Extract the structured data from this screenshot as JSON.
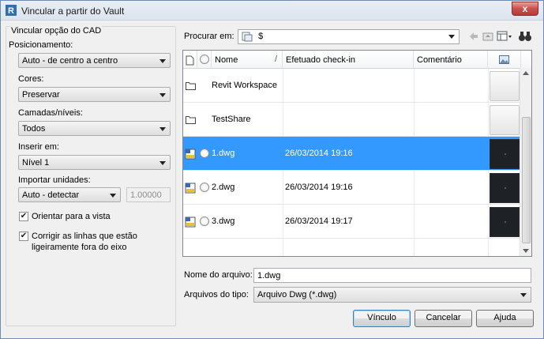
{
  "window": {
    "title": "Vincular a partir do Vault",
    "close_glyph": "x"
  },
  "cad_options": {
    "group_title": "Vincular opção do CAD",
    "positioning": {
      "label": "Posicionamento:",
      "value": "Auto - de centro a centro"
    },
    "colors": {
      "label": "Cores:",
      "value": "Preservar"
    },
    "layers": {
      "label": "Camadas/níveis:",
      "value": "Todos"
    },
    "insert": {
      "label": "Inserir em:",
      "value": "Nível 1"
    },
    "units": {
      "label": "Importar unidades:",
      "value": "Auto - detectar",
      "factor": "1.00000"
    },
    "orient": {
      "label": "Orientar para a vista",
      "checked": true
    },
    "correct": {
      "label_line1": "Corrigir as linhas que estão",
      "label_line2": "ligeiramente fora do eixo",
      "checked": true
    }
  },
  "browser": {
    "search_label": "Procurar em:",
    "search_value": "$",
    "columns": {
      "name": "Nome",
      "sort_glyph": "/",
      "checkin": "Efetuado check-in",
      "comment": "Comentário"
    },
    "rows": [
      {
        "name": "Revit Workspace",
        "date": "",
        "type": "folder",
        "selected": false
      },
      {
        "name": "TestShare",
        "date": "",
        "type": "folder",
        "selected": false
      },
      {
        "name": "1.dwg",
        "date": "26/03/2014 19:16",
        "type": "dwg",
        "selected": true
      },
      {
        "name": "2.dwg",
        "date": "26/03/2014 19:16",
        "type": "dwg",
        "selected": false
      },
      {
        "name": "3.dwg",
        "date": "26/03/2014 19:17",
        "type": "dwg",
        "selected": false
      }
    ]
  },
  "file": {
    "name_label": "Nome do arquivo:",
    "name_value": "1.dwg",
    "type_label": "Arquivos do tipo:",
    "type_value": "Arquivo Dwg (*.dwg)"
  },
  "buttons": {
    "link": "Vínculo",
    "cancel": "Cancelar",
    "help": "Ajuda"
  },
  "colors": {
    "selection": "#3399ff",
    "window_bg": "#f0f0f0"
  }
}
